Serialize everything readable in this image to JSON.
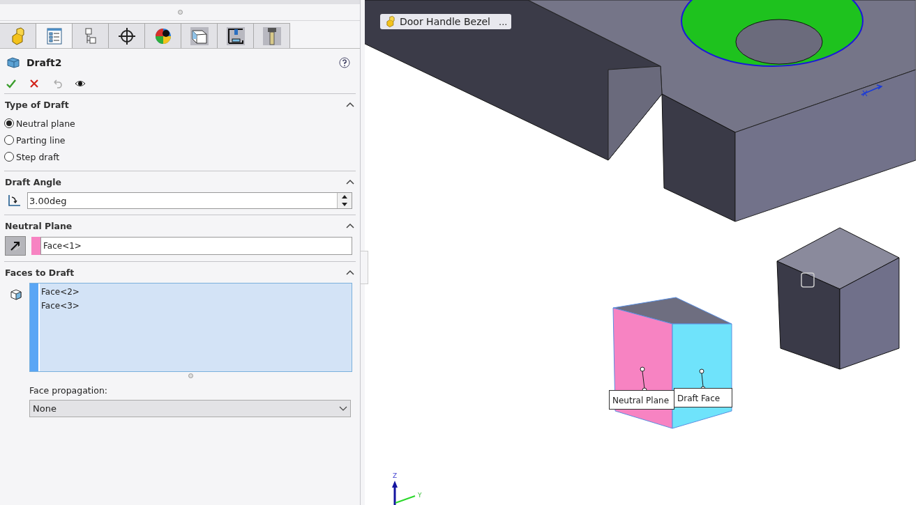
{
  "tabs": [
    {
      "kind": "part",
      "selected": false
    },
    {
      "kind": "properties",
      "selected": true
    },
    {
      "kind": "config",
      "selected": false
    },
    {
      "kind": "crosshair",
      "selected": false
    },
    {
      "kind": "appearance",
      "selected": false
    },
    {
      "kind": "view",
      "selected": false
    },
    {
      "kind": "machine",
      "selected": false
    },
    {
      "kind": "tool",
      "selected": false
    }
  ],
  "feature": {
    "title": "Draft2"
  },
  "sections": [
    {
      "kind": "radios",
      "title": "Type of Draft",
      "expanded": true,
      "options": [
        {
          "label": "Neutral plane",
          "selected": true
        },
        {
          "label": "Parting line",
          "selected": false
        },
        {
          "label": "Step draft",
          "selected": false
        }
      ]
    },
    {
      "kind": "spinner",
      "title": "Draft Angle",
      "expanded": true,
      "value": "3.00deg"
    },
    {
      "kind": "selection",
      "title": "Neutral Plane",
      "expanded": true,
      "value": "Face<1>",
      "color": "#f783c2"
    },
    {
      "kind": "list",
      "title": "Faces to Draft",
      "expanded": true,
      "items": [
        "Face<2>",
        "Face<3>"
      ],
      "propagation_label": "Face propagation:",
      "propagation_value": "None"
    }
  ],
  "viewport": {
    "breadcrumb": "Door Handle Bezel",
    "breadcrumb_more": "...",
    "callouts": [
      {
        "label": "Neutral Plane"
      },
      {
        "label": "Draft Face"
      }
    ],
    "axes": {
      "z": "Z",
      "y": "Y"
    }
  }
}
